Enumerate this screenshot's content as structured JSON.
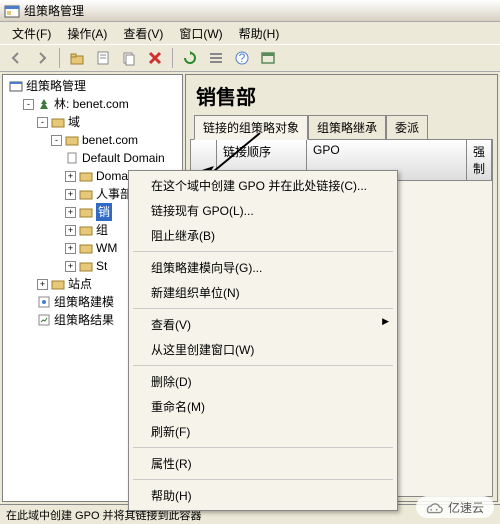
{
  "window_title": "组策略管理",
  "menubar": [
    "文件(F)",
    "操作(A)",
    "查看(V)",
    "窗口(W)",
    "帮助(H)"
  ],
  "tree": {
    "root": "组策略管理",
    "forest": "林: benet.com",
    "domains": "域",
    "domain": "benet.com",
    "items": [
      "Default Domain",
      "Domain Control",
      "人事部",
      "销",
      "组",
      "WM",
      "St"
    ],
    "sites": "站点",
    "gpm": "组策略建模",
    "gpr": "组策略结果"
  },
  "right": {
    "title": "销售部",
    "tabs": [
      "链接的组策略对象",
      "组策略继承",
      "委派"
    ],
    "columns": [
      "",
      "链接顺序",
      "GPO",
      "强制"
    ]
  },
  "context_menu": [
    "在这个域中创建 GPO 并在此处链接(C)...",
    "链接现有 GPO(L)...",
    "阻止继承(B)",
    "---",
    "组策略建模向导(G)...",
    "新建组织单位(N)",
    "---",
    "查看(V)",
    "从这里创建窗口(W)",
    "---",
    "删除(D)",
    "重命名(M)",
    "刷新(F)",
    "---",
    "属性(R)",
    "---",
    "帮助(H)"
  ],
  "status": "在此域中创建 GPO 并将其链接到此容器",
  "watermark": "亿速云"
}
